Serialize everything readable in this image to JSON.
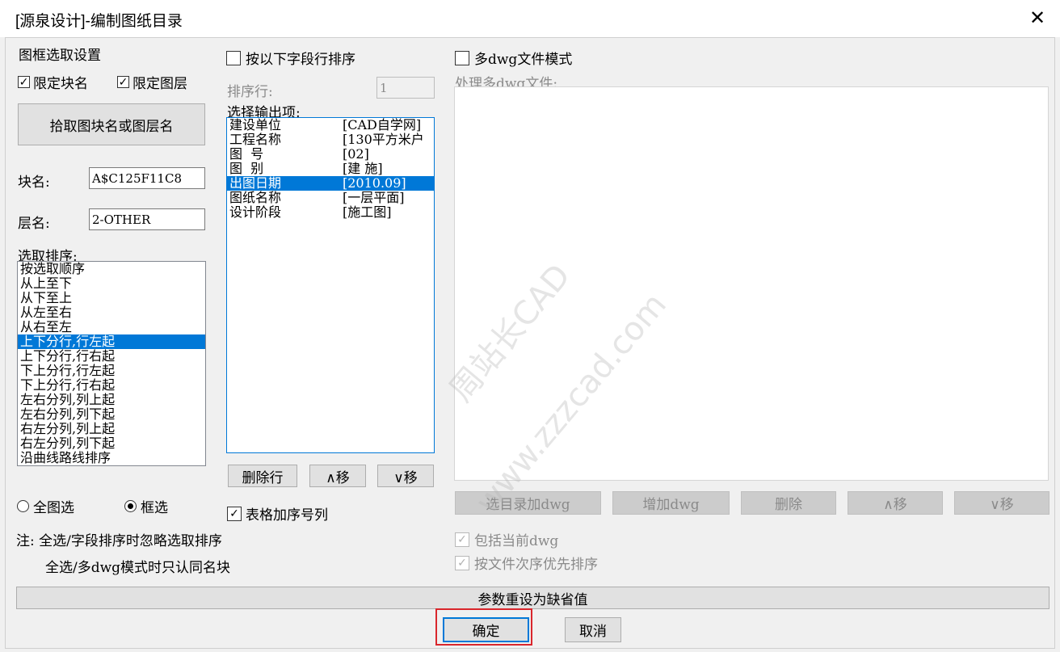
{
  "window": {
    "title": "[源泉设计]-编制图纸目录",
    "close_icon": "close-icon"
  },
  "left": {
    "group_title": "图框选取设置",
    "limit_block": {
      "label": "限定块名",
      "checked": true
    },
    "limit_layer": {
      "label": "限定图层",
      "checked": true
    },
    "pick_button": "拾取图块名或图层名",
    "block_label": "块名:",
    "block_value": "A$C125F11C8",
    "layer_label": "层名:",
    "layer_value": "2-OTHER",
    "order_label": "选取排序:",
    "order_items": [
      "按选取顺序",
      "从上至下",
      "从下至上",
      "从左至右",
      "从右至左",
      "上下分行,行左起",
      "上下分行,行右起",
      "下上分行,行左起",
      "下上分行,行右起",
      "左右分列,列上起",
      "左右分列,列下起",
      "右左分列,列上起",
      "右左分列,列下起",
      "沿曲线路线排序"
    ],
    "order_selected_index": 5,
    "radio_all": "全图选",
    "radio_box": "框选",
    "radio_selected": "框选",
    "note1": "注: 全选/字段排序时忽略选取排序",
    "note2": "全选/多dwg模式时只认同名块"
  },
  "middle": {
    "sort_checkbox": {
      "label": "按以下字段行排序",
      "checked": false
    },
    "sort_row_label": "排序行:",
    "sort_row_value": "1",
    "output_label": "选择输出项:",
    "output_items": [
      {
        "name": "建设单位",
        "value": "[CAD自学网]"
      },
      {
        "name": "工程名称",
        "value": "[130平方米户"
      },
      {
        "name": "图  号",
        "value": "[02]"
      },
      {
        "name": "图  别",
        "value": "[建 施]"
      },
      {
        "name": "出图日期",
        "value": "[2010.09]"
      },
      {
        "name": "图纸名称",
        "value": "[一层平面]"
      },
      {
        "name": "设计阶段",
        "value": "[施工图]"
      }
    ],
    "output_selected_index": 4,
    "delete_row": "删除行",
    "move_up": "∧移",
    "move_down": "∨移",
    "table_seq": {
      "label": "表格加序号列",
      "checked": true
    }
  },
  "right": {
    "multi_dwg": {
      "label": "多dwg文件模式",
      "checked": false
    },
    "process_label": "处理多dwg文件:",
    "btn_add_dir": "选目录加dwg",
    "btn_add": "增加dwg",
    "btn_delete": "删除",
    "btn_up": "∧移",
    "btn_down": "∨移",
    "include_current": {
      "label": "包括当前dwg",
      "checked": true
    },
    "file_order": {
      "label": "按文件次序优先排序",
      "checked": true
    }
  },
  "footer": {
    "reset": "参数重设为缺省值",
    "ok": "确定",
    "cancel": "取消"
  },
  "watermark": {
    "line1": "周站长CAD",
    "line2": "www.zzzcad.com"
  },
  "colors": {
    "selection": "#0078d7",
    "highlight_box": "#d9262c"
  }
}
